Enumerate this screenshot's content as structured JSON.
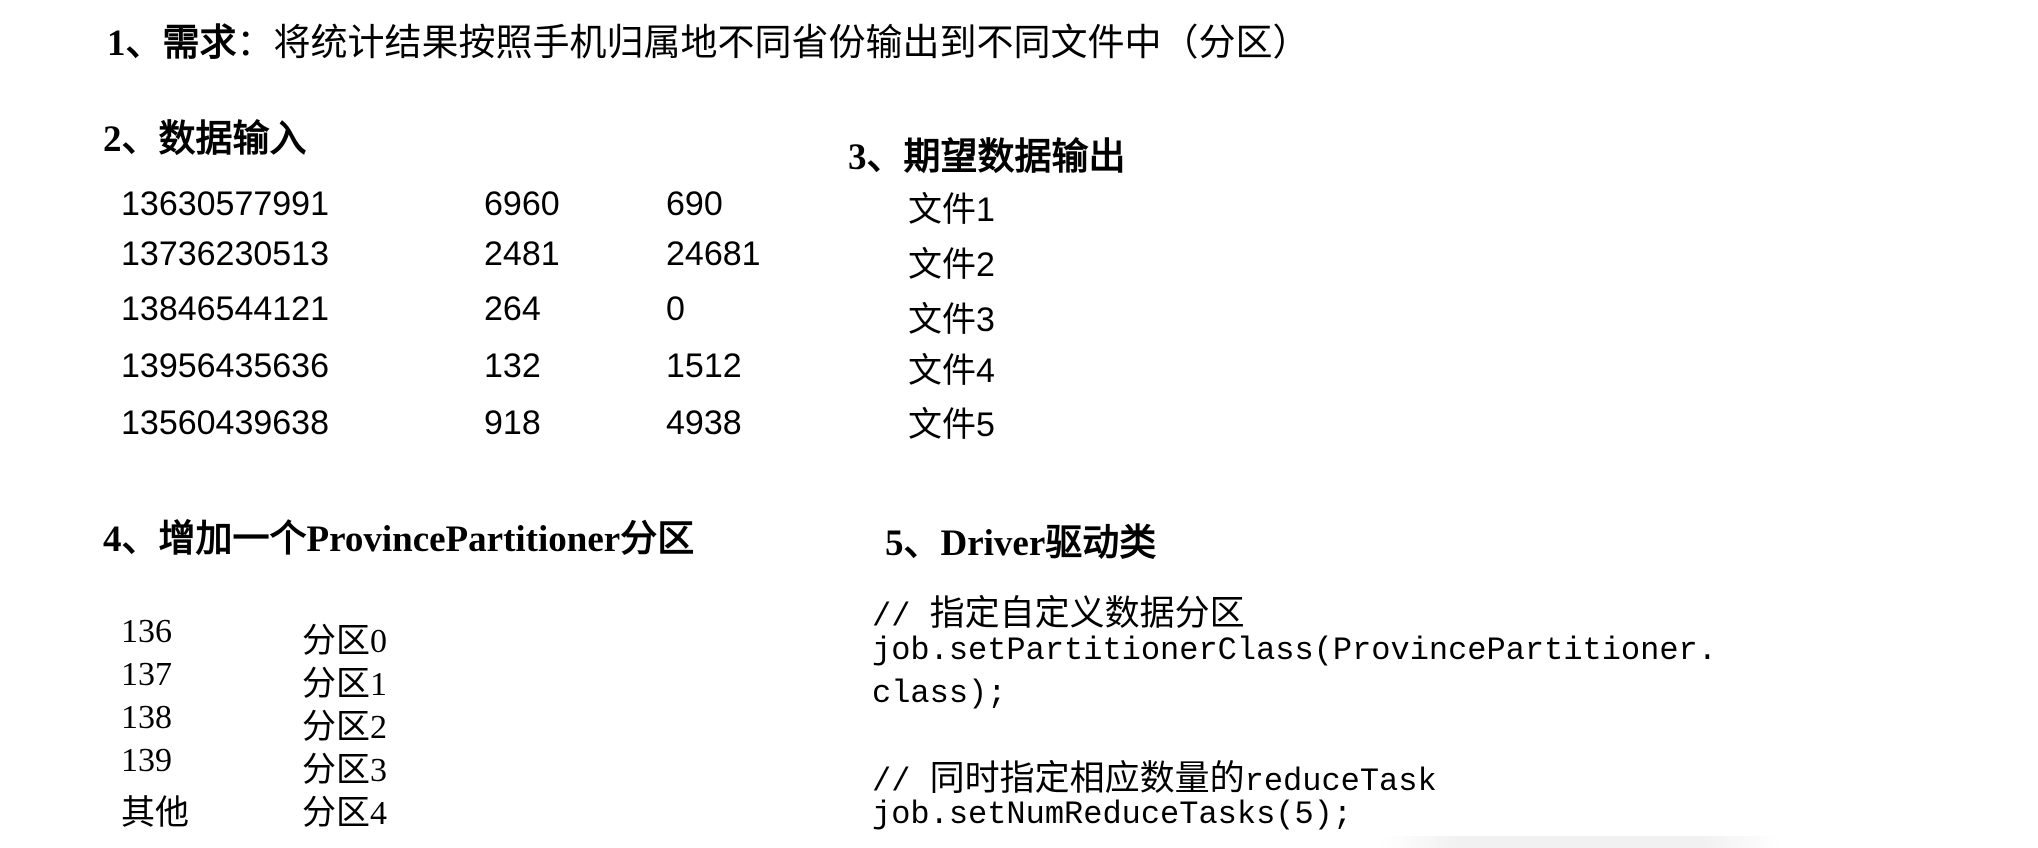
{
  "requirement": {
    "number": "1、",
    "keyword": "需求",
    "text": "：将统计结果按照手机归属地不同省份输出到不同文件中（分区）"
  },
  "sections": {
    "data_input": {
      "number": "2、",
      "title": "数据输入"
    },
    "expected_output": {
      "number": "3、",
      "title": "期望数据输出"
    },
    "partitioner": {
      "number": "4、",
      "title_pre": "增加一个",
      "title_latin": "ProvincePartitioner",
      "title_post": "分区"
    },
    "driver": {
      "number": "5、",
      "title_latin": "Driver",
      "title_post": "驱动类"
    }
  },
  "input_rows": [
    {
      "phone": "13630577991",
      "up": "6960",
      "down": "690"
    },
    {
      "phone": "13736230513",
      "up": "2481",
      "down": "24681"
    },
    {
      "phone": "13846544121",
      "up": "264",
      "down": "0"
    },
    {
      "phone": "13956435636",
      "up": "132",
      "down": "1512"
    },
    {
      "phone": "13560439638",
      "up": "918",
      "down": "4938"
    }
  ],
  "output_files": [
    "文件1",
    "文件2",
    "文件3",
    "文件4",
    "文件5"
  ],
  "partitions": [
    {
      "prefix": "136",
      "partition": "分区0"
    },
    {
      "prefix": "137",
      "partition": "分区1"
    },
    {
      "prefix": "138",
      "partition": "分区2"
    },
    {
      "prefix": "139",
      "partition": "分区3"
    },
    {
      "prefix": "其他",
      "partition": "分区4"
    }
  ],
  "driver_code": {
    "comment1_slash": "// ",
    "comment1_text": "指定自定义数据分区",
    "line1": "job.setPartitionerClass(ProvincePartitioner.",
    "line2": "class);",
    "comment2_slash": "// ",
    "comment2_text": "同时指定相应数量的",
    "comment2_tail": "reduceTask",
    "line3": "job.setNumReduceTasks(5);"
  }
}
